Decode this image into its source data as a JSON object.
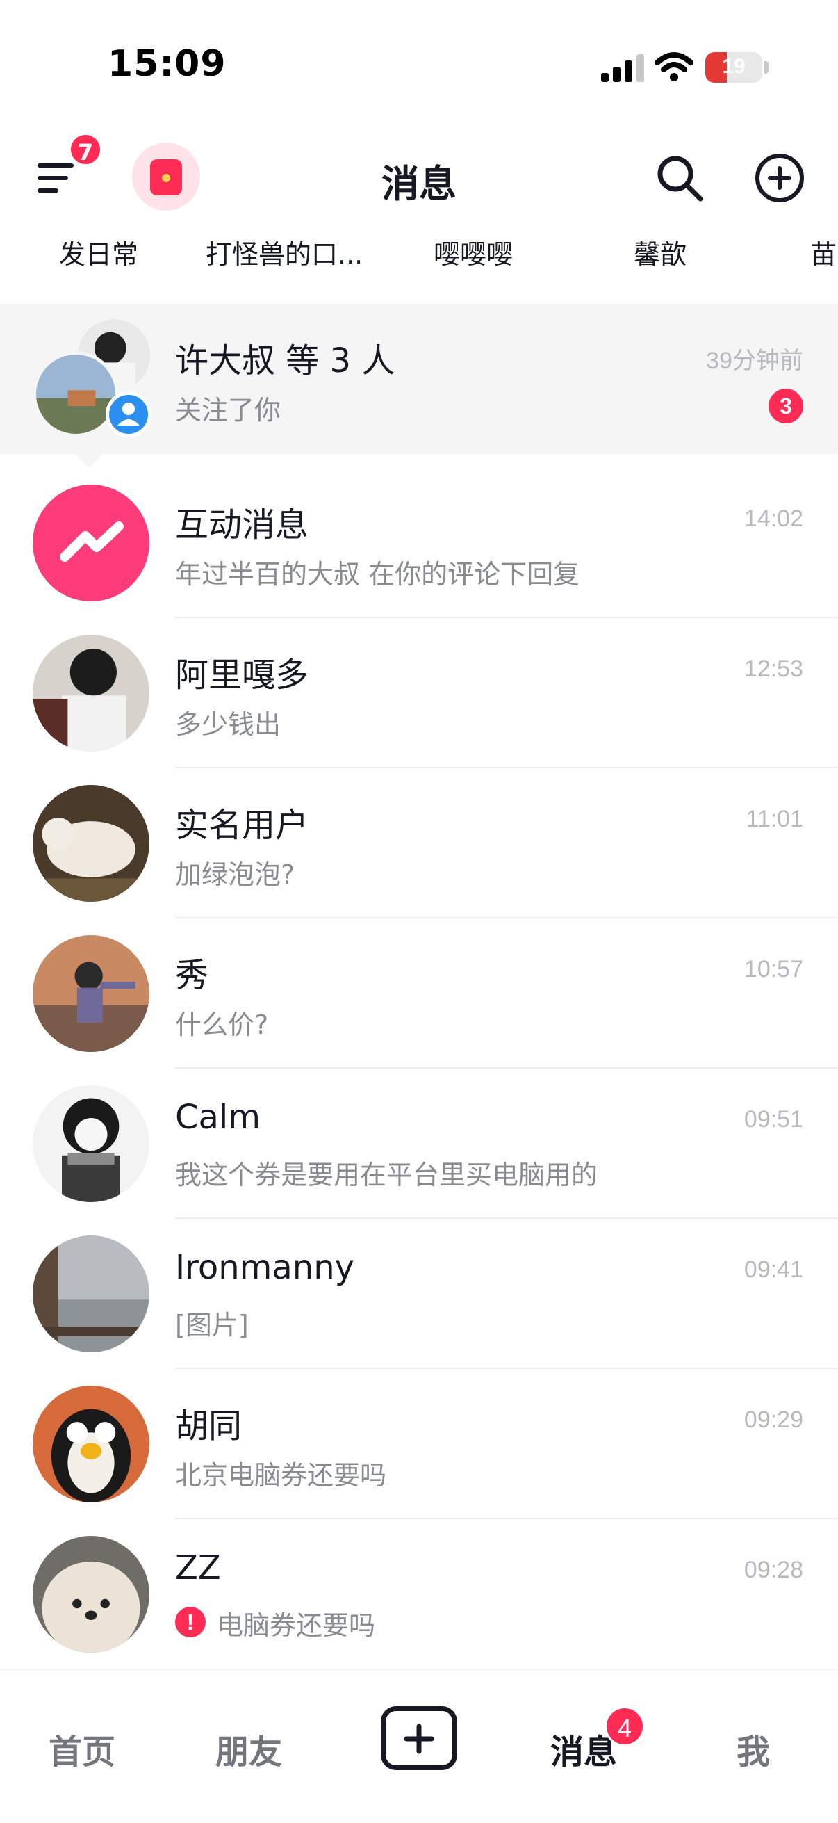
{
  "status_bar": {
    "time": "15:09",
    "battery": "19",
    "battery_level": 0.19,
    "battery_color": "#e53935"
  },
  "header": {
    "title": "消息",
    "menu_badge": "7",
    "icons": [
      "menu-icon",
      "red-packet-icon",
      "search-icon",
      "add-circle-icon"
    ]
  },
  "stories": [
    "发日常",
    "打怪兽的口...",
    "嘤嘤嘤",
    "馨歆",
    "苗"
  ],
  "messages": [
    {
      "name": "许大叔 等 3 人",
      "preview": "关注了你",
      "time": "39分钟前",
      "badge": "3"
    },
    {
      "name": "互动消息",
      "preview": "年过半百的大叔 在你的评论下回复",
      "time": "14:02"
    },
    {
      "name": "阿里嘎多",
      "preview": "多少钱出",
      "time": "12:53"
    },
    {
      "name": "实名用户",
      "preview": "加绿泡泡?",
      "time": "11:01"
    },
    {
      "name": "秀",
      "preview": "什么价?",
      "time": "10:57"
    },
    {
      "name": "Calm",
      "preview": "我这个券是要用在平台里买电脑用的",
      "time": "09:51"
    },
    {
      "name": "Ironmanny",
      "preview": "[图片]",
      "time": "09:41"
    },
    {
      "name": "胡同",
      "preview": "北京电脑券还要吗",
      "time": "09:29"
    },
    {
      "name": "ZZ",
      "preview": "电脑券还要吗",
      "time": "09:28",
      "warning": "!"
    }
  ],
  "tabbar": {
    "tabs": [
      "首页",
      "朋友",
      "消息",
      "我"
    ],
    "active": "消息",
    "message_badge": "4"
  },
  "colors": {
    "accent": "#fe2c55",
    "text": "#161823",
    "secondary": "#8a8b91",
    "time": "#b8b9be"
  }
}
